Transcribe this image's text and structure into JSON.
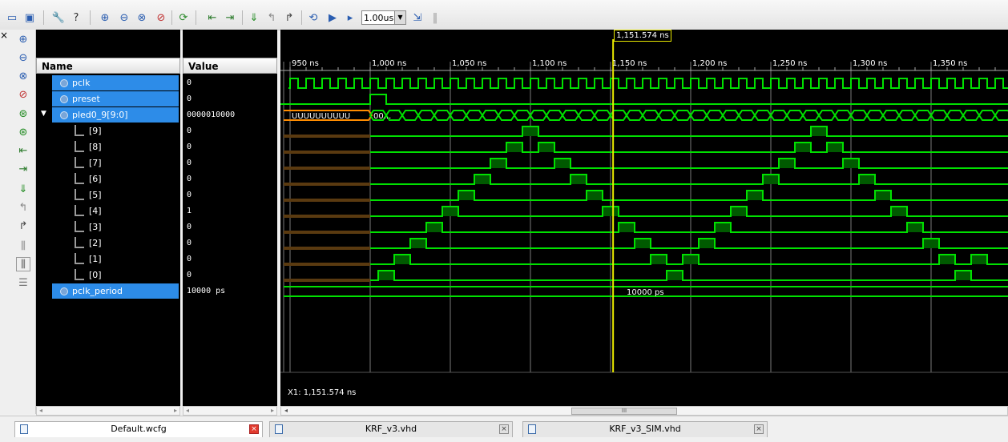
{
  "toolbar": {
    "icons": [
      "layout-icon",
      "window-icon",
      "wrench-icon",
      "help-icon",
      "zoom-in-icon",
      "zoom-out-icon",
      "zoom-fit-icon",
      "zoom-cursor-icon",
      "refresh-icon",
      "go-previous-icon",
      "go-next-icon",
      "add-marker-icon",
      "undo-icon",
      "redo-icon",
      "restart-icon",
      "run-icon",
      "run-for-icon",
      "break-icon",
      "step-icon"
    ],
    "run_time": "1.00us"
  },
  "left_tools": [
    "zoom-in-icon",
    "zoom-out-icon",
    "zoom-fit-icon",
    "zoom-cursor-icon",
    "go-start-icon",
    "go-end-icon",
    "prev-edge-icon",
    "next-edge-icon",
    "add-marker-icon",
    "prev-marker-icon",
    "next-marker-icon",
    "swap-cursor-icon",
    "snap-icon",
    "bus-icon"
  ],
  "columns": {
    "name": "Name",
    "value": "Value"
  },
  "signals": [
    {
      "name": "pclk",
      "value": "0",
      "selected": true,
      "indent": 0
    },
    {
      "name": "preset",
      "value": "0",
      "selected": true,
      "indent": 0
    },
    {
      "name": "pled0_9[9:0]",
      "value": "0000010000",
      "selected": true,
      "indent": 0,
      "expanded": true
    },
    {
      "name": "[9]",
      "value": "0",
      "selected": false,
      "indent": 1
    },
    {
      "name": "[8]",
      "value": "0",
      "selected": false,
      "indent": 1
    },
    {
      "name": "[7]",
      "value": "0",
      "selected": false,
      "indent": 1
    },
    {
      "name": "[6]",
      "value": "0",
      "selected": false,
      "indent": 1
    },
    {
      "name": "[5]",
      "value": "0",
      "selected": false,
      "indent": 1
    },
    {
      "name": "[4]",
      "value": "1",
      "selected": false,
      "indent": 1
    },
    {
      "name": "[3]",
      "value": "0",
      "selected": false,
      "indent": 1
    },
    {
      "name": "[2]",
      "value": "0",
      "selected": false,
      "indent": 1
    },
    {
      "name": "[1]",
      "value": "0",
      "selected": false,
      "indent": 1
    },
    {
      "name": "[0]",
      "value": "0",
      "selected": false,
      "indent": 1
    },
    {
      "name": "pclk_period",
      "value": "10000 ps",
      "selected": true,
      "indent": 0
    }
  ],
  "timeline": {
    "ticks": [
      "950 ns",
      "1,000 ns",
      "1,050 ns",
      "1,100 ns",
      "1,150 ns",
      "1,200 ns",
      "1,250 ns",
      "1,300 ns",
      "1,350 ns"
    ],
    "cursor_label": "1,151.574 ns",
    "cursor_ns": 1151.574,
    "bus_undefined": "UUUUUUUUUU",
    "bus_first": "00...",
    "period_label": "10000 ps",
    "x1_readout": "X1: 1,151.574 ns"
  },
  "colors": {
    "wave": "#00e000",
    "cursor": "#e8e800",
    "undefined": "#ff8c00",
    "selection": "#2d8ce8"
  },
  "tabs": [
    {
      "label": "Default.wcfg",
      "active": true
    },
    {
      "label": "KRF_v3.vhd",
      "active": false
    },
    {
      "label": "KRF_v3_SIM.vhd",
      "active": false
    }
  ],
  "close_glyph": "×",
  "scroll_thumb": "III"
}
